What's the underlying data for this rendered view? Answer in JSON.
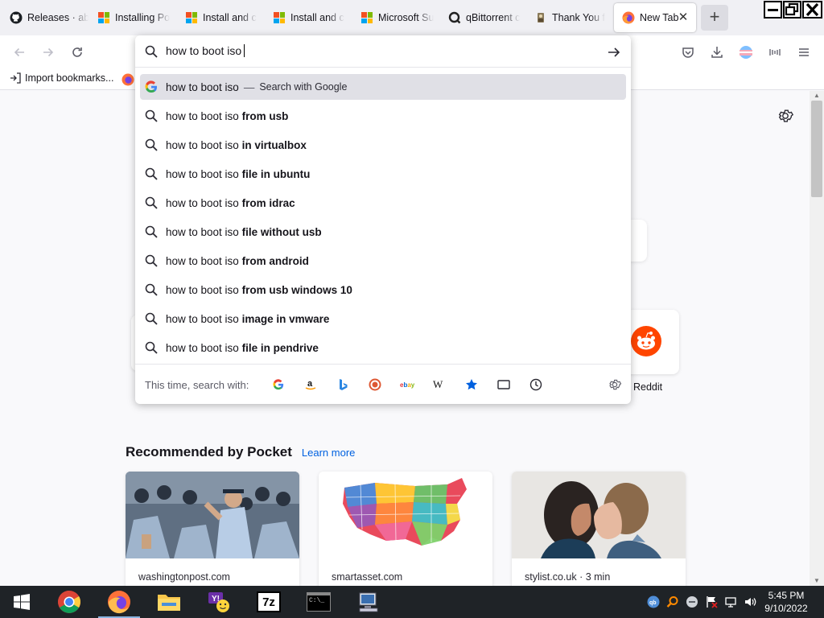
{
  "tabs": [
    {
      "title": "Releases · ab",
      "icon": "github-icon"
    },
    {
      "title": "Installing Po",
      "icon": "microsoft-logo-icon"
    },
    {
      "title": "Install and c",
      "icon": "microsoft-logo-icon"
    },
    {
      "title": "Install and c",
      "icon": "microsoft-logo-icon"
    },
    {
      "title": "Microsoft Su",
      "icon": "microsoft-logo-icon"
    },
    {
      "title": "qBittorrent c",
      "icon": "qbittorrent-icon"
    },
    {
      "title": "Thank You f",
      "icon": "thank-you-icon"
    },
    {
      "title": "New Tab",
      "icon": "firefox-icon",
      "active": true
    }
  ],
  "bookmarks": {
    "import_label": "Import bookmarks..."
  },
  "urlbar": {
    "value": "how to boot iso",
    "first_suggestion": {
      "text": "how to boot iso",
      "separator": "—",
      "action": "Search with Google"
    },
    "suggestions": [
      {
        "prefix": "how to boot iso",
        "bold": "from usb"
      },
      {
        "prefix": "how to boot iso",
        "bold": "in virtualbox"
      },
      {
        "prefix": "how to boot iso",
        "bold": "file in ubuntu"
      },
      {
        "prefix": "how to boot iso",
        "bold": "from idrac"
      },
      {
        "prefix": "how to boot iso",
        "bold": "file without usb"
      },
      {
        "prefix": "how to boot iso",
        "bold": "from android"
      },
      {
        "prefix": "how to boot iso",
        "bold": "from usb windows 10"
      },
      {
        "prefix": "how to boot iso",
        "bold": "image in vmware"
      },
      {
        "prefix": "how to boot iso",
        "bold": "file in pendrive"
      }
    ],
    "oneoff_label": "This time, search with:",
    "engines": [
      "google-icon",
      "amazon-icon",
      "bing-icon",
      "duckduckgo-icon",
      "ebay-icon",
      "wikipedia-icon",
      "bookmarks-star-icon",
      "tabs-icon",
      "history-icon"
    ]
  },
  "newtab": {
    "top_site_label": "Reddit",
    "pocket_title": "Recommended by Pocket",
    "pocket_learn_more": "Learn more",
    "stories": [
      {
        "source": "washingtonpost.com"
      },
      {
        "source": "smartasset.com"
      },
      {
        "source": "stylist.co.uk · 3 min"
      }
    ]
  },
  "taskbar": {
    "apps": [
      "chrome-icon",
      "firefox-icon",
      "file-explorer-icon",
      "yahoo-messenger-icon",
      "7zip-icon",
      "command-prompt-icon",
      "network-computer-icon"
    ],
    "seven_zip_label": "7z",
    "cmd_label": "C:\\_",
    "time": "5:45 PM",
    "date": "9/10/2022"
  },
  "colors": {
    "accent": "#0061e0",
    "selected_row": "#e0e0e6",
    "taskbar": "#1f2327"
  }
}
